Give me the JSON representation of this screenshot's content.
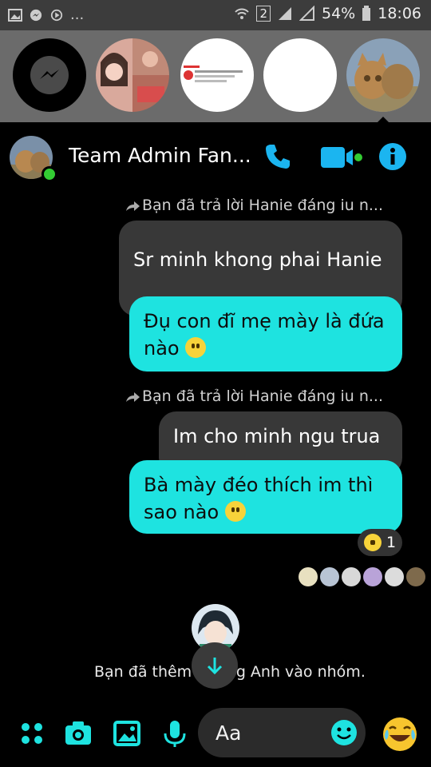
{
  "status_bar": {
    "overflow_label": "...",
    "sim_label": "2",
    "battery": "54%",
    "time": "18:06"
  },
  "chat_heads": [
    "messenger-icon",
    "avatar-girls",
    "avatar-document",
    "avatar-blank",
    "avatar-cats"
  ],
  "header": {
    "title": "Team Admin Fan...",
    "online": true
  },
  "messages": [
    {
      "type": "reply_note",
      "text": "Bạn đã trả lời Hanie đáng iu n..."
    },
    {
      "type": "quoted",
      "text": "Sr minh khong phai Hanie"
    },
    {
      "type": "sent",
      "text": "Đụ con đĩ mẹ mày là đứa nào"
    },
    {
      "type": "reply_note",
      "text": "Bạn đã trả lời Hanie đáng iu n..."
    },
    {
      "type": "quoted",
      "text": "Im cho minh ngu trua"
    },
    {
      "type": "sent",
      "text": "Bà mày đéo thích im thì sao nào"
    }
  ],
  "reaction": {
    "emoji": "laughing-emoji",
    "count": "1"
  },
  "system_message": "Bạn đã thêm Hoàng Anh vào nhóm.",
  "composer": {
    "placeholder": "Aa"
  },
  "colors": {
    "accent": "#1ee3e0",
    "icon_blue": "#1bb5f0",
    "online": "#33cc33"
  }
}
